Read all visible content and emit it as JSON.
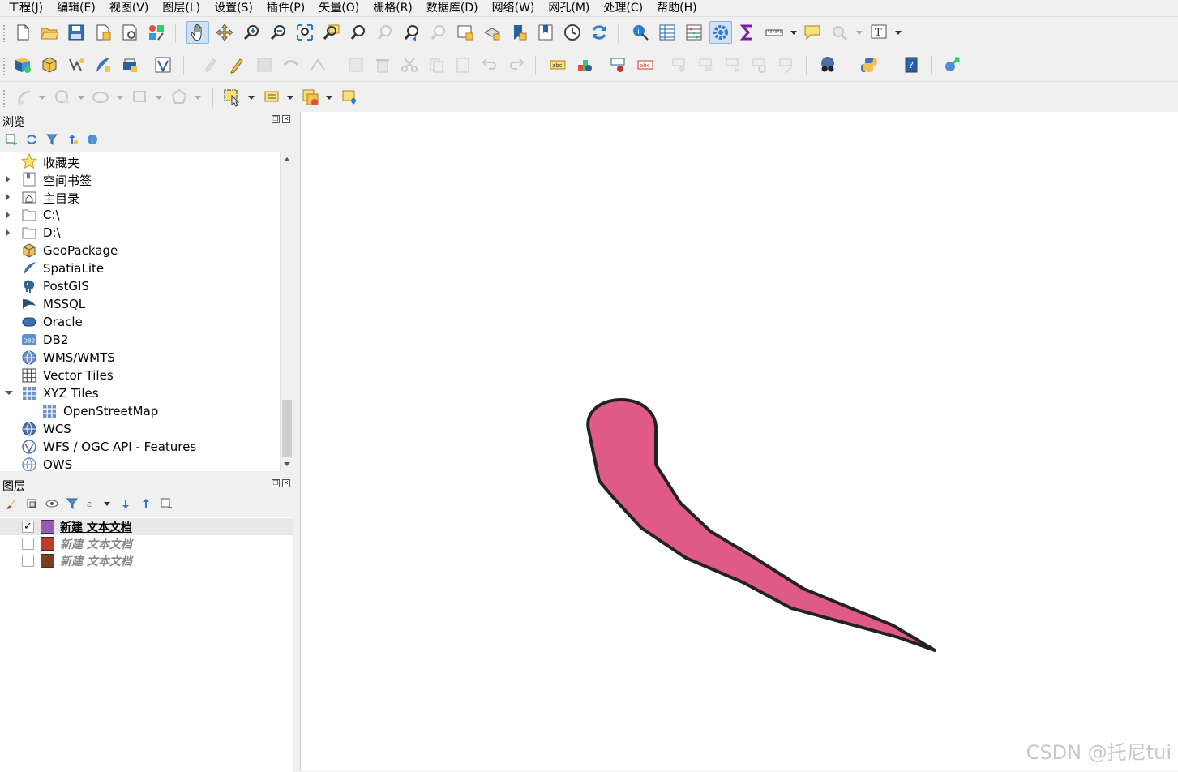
{
  "menu": [
    "工程(J)",
    "编辑(E)",
    "视图(V)",
    "图层(L)",
    "设置(S)",
    "插件(P)",
    "矢量(O)",
    "栅格(R)",
    "数据库(D)",
    "网络(W)",
    "网孔(M)",
    "处理(C)",
    "帮助(H)"
  ],
  "browser": {
    "title": "浏览",
    "items": [
      {
        "label": "收藏夹"
      },
      {
        "label": "空间书签"
      },
      {
        "label": "主目录"
      },
      {
        "label": "C:\\"
      },
      {
        "label": "D:\\"
      },
      {
        "label": "GeoPackage"
      },
      {
        "label": "SpatiaLite"
      },
      {
        "label": "PostGIS"
      },
      {
        "label": "MSSQL"
      },
      {
        "label": "Oracle"
      },
      {
        "label": "DB2"
      },
      {
        "label": "WMS/WMTS"
      },
      {
        "label": "Vector Tiles"
      },
      {
        "label": "XYZ Tiles"
      },
      {
        "label": "OpenStreetMap"
      },
      {
        "label": "WCS"
      },
      {
        "label": "WFS / OGC API - Features"
      },
      {
        "label": "OWS"
      }
    ]
  },
  "layers": {
    "title": "图层",
    "items": [
      {
        "name": "新建 文本文档",
        "checked": "✓",
        "color": "#9b59b6"
      },
      {
        "name": "新建 文本文档",
        "checked": "",
        "color": "#c0392b"
      },
      {
        "name": "新建 文本文档",
        "checked": "",
        "color": "#7b3f1e"
      }
    ]
  },
  "map": {
    "feature_fill": "#e05a88",
    "feature_stroke": "#222222"
  },
  "watermark": "CSDN @托尼tui"
}
